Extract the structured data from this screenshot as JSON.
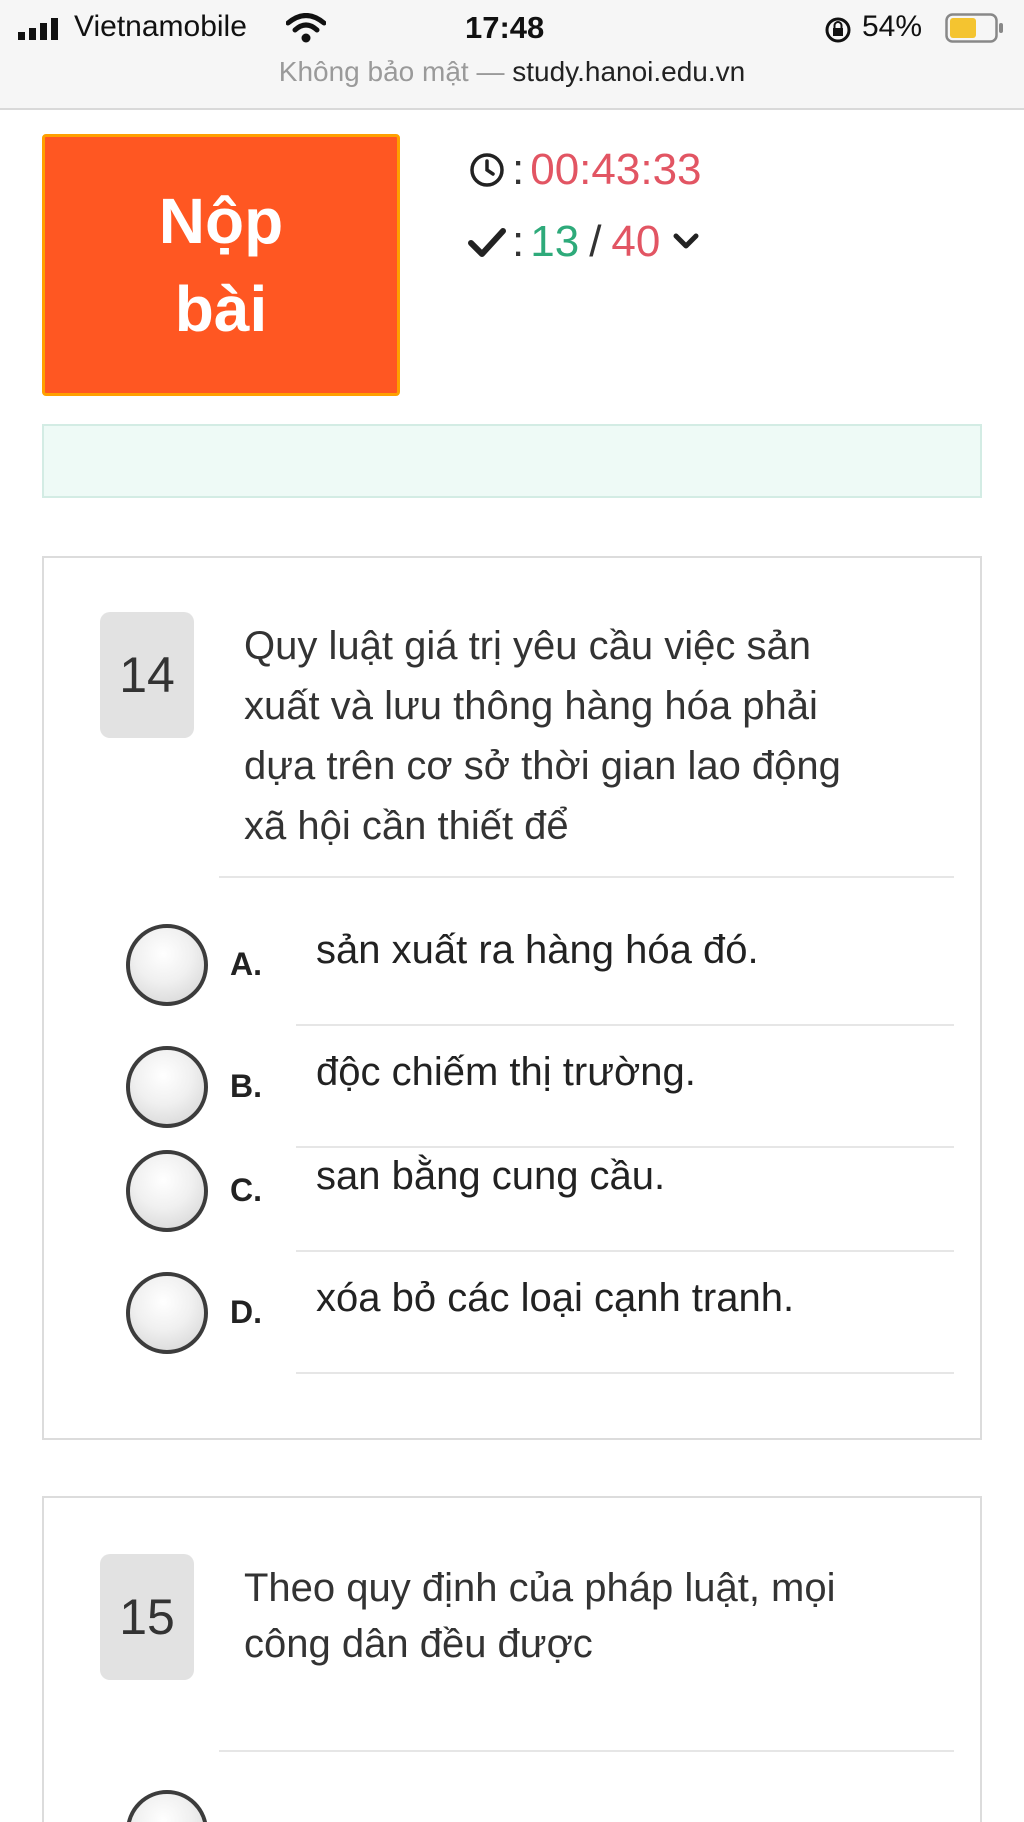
{
  "status_bar": {
    "carrier": "Vietnamobile",
    "time": "17:48",
    "battery_percent": "54%",
    "icons": [
      "signal-icon",
      "wifi-icon",
      "orientation-lock-icon",
      "battery-icon"
    ]
  },
  "url_bar": {
    "security_label": "Không bảo mật —",
    "domain": "study.hanoi.edu.vn"
  },
  "header": {
    "submit_line1": "Nộp",
    "submit_line2": "bài",
    "timer": "00:43:33",
    "answered": "13",
    "total": "40",
    "colon": ":",
    "slash": "/"
  },
  "colors": {
    "submit_bg": "#ff5722",
    "submit_border": "#ffa000",
    "timer_red": "#e25563",
    "answered_green": "#2eaa7a",
    "info_strip": "#eefaf6"
  },
  "questions": [
    {
      "number": "14",
      "lines": [
        "Quy luật giá trị yêu cầu việc sản",
        "xuất và lưu thông hàng hóa phải",
        "dựa trên cơ sở thời gian lao động",
        "xã hội cần thiết để"
      ],
      "options": [
        {
          "letter": "A.",
          "text": "sản xuất ra hàng hóa đó."
        },
        {
          "letter": "B.",
          "text": "độc chiếm thị trường."
        },
        {
          "letter": "C.",
          "text": "san bằng cung cầu."
        },
        {
          "letter": "D.",
          "text": "xóa bỏ các loại cạnh tranh."
        }
      ]
    },
    {
      "number": "15",
      "lines": [
        "Theo quy định của pháp luật, mọi",
        "công dân đều được"
      ]
    }
  ]
}
